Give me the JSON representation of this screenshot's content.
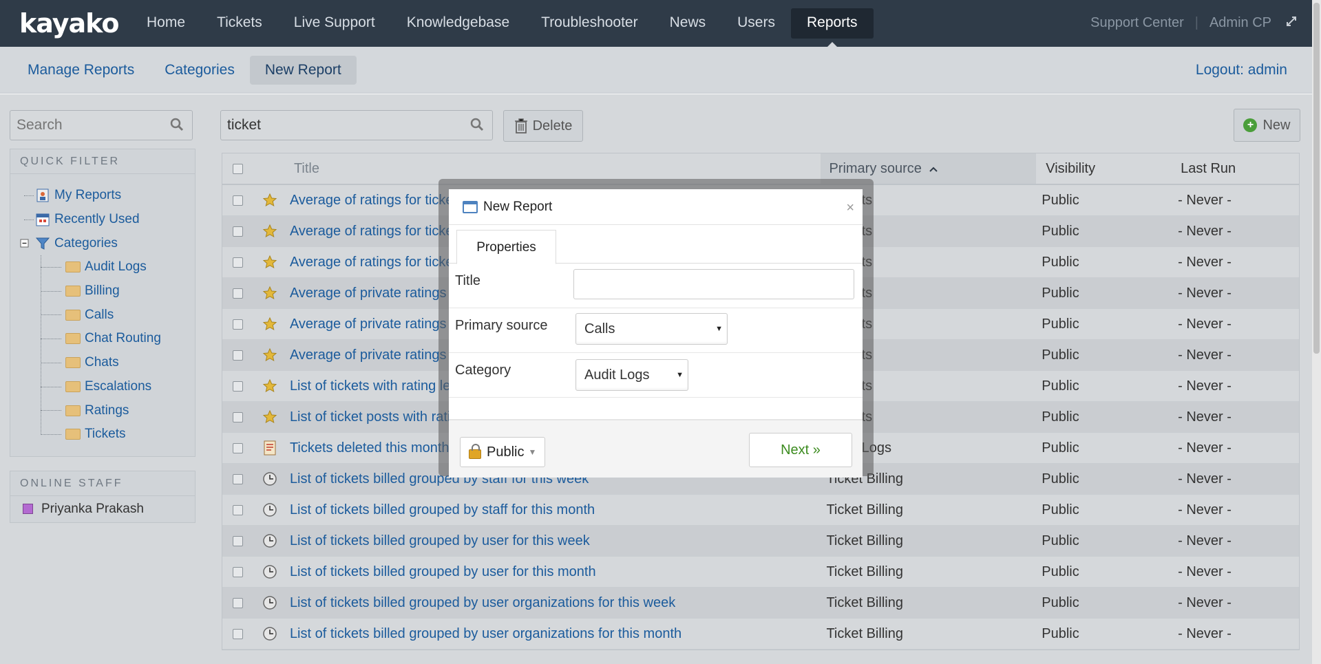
{
  "app": {
    "logo": "kayako"
  },
  "topnav": {
    "items": [
      "Home",
      "Tickets",
      "Live Support",
      "Knowledgebase",
      "Troubleshooter",
      "News",
      "Users",
      "Reports"
    ],
    "active": "Reports",
    "support_center": "Support Center",
    "separator": "|",
    "admin_cp": "Admin CP"
  },
  "subnav": {
    "links": [
      "Manage Reports",
      "Categories",
      "New Report"
    ],
    "active": "New Report",
    "logout": "Logout: admin"
  },
  "sidebar": {
    "search_placeholder": "Search",
    "quick_filter_title": "QUICK FILTER",
    "my_reports": "My Reports",
    "recently_used": "Recently Used",
    "categories": "Categories",
    "category_items": [
      "Audit Logs",
      "Billing",
      "Calls",
      "Chat Routing",
      "Chats",
      "Escalations",
      "Ratings",
      "Tickets"
    ],
    "online_staff_title": "ONLINE STAFF",
    "staff": [
      "Priyanka Prakash"
    ]
  },
  "toolbar": {
    "search_value": "ticket",
    "delete_label": "Delete",
    "new_label": "New"
  },
  "grid": {
    "headers": {
      "title": "Title",
      "source": "Primary source",
      "visibility": "Visibility",
      "last_run": "Last Run"
    },
    "rows": [
      {
        "icon": "star-icon",
        "title": "Average of ratings for ticke",
        "source": "Results",
        "visibility": "Public",
        "last_run": "- Never -"
      },
      {
        "icon": "star-icon",
        "title": "Average of ratings for ticke",
        "source": "Results",
        "visibility": "Public",
        "last_run": "- Never -"
      },
      {
        "icon": "star-icon",
        "title": "Average of ratings for ticke",
        "source": "Results",
        "visibility": "Public",
        "last_run": "- Never -"
      },
      {
        "icon": "star-icon",
        "title": "Average of private ratings",
        "source": "Results",
        "visibility": "Public",
        "last_run": "- Never -"
      },
      {
        "icon": "star-icon",
        "title": "Average of private ratings",
        "source": "Results",
        "visibility": "Public",
        "last_run": "- Never -"
      },
      {
        "icon": "star-icon",
        "title": "Average of private ratings",
        "source": "Results",
        "visibility": "Public",
        "last_run": "- Never -"
      },
      {
        "icon": "star-icon",
        "title": "List of tickets with rating le",
        "source": "Results",
        "visibility": "Public",
        "last_run": "- Never -"
      },
      {
        "icon": "star-icon",
        "title": "List of ticket posts with rati",
        "source": "Results",
        "visibility": "Public",
        "last_run": "- Never -"
      },
      {
        "icon": "document-icon",
        "title": "Tickets deleted this month",
        "source": "Audit Logs",
        "visibility": "Public",
        "last_run": "- Never -"
      },
      {
        "icon": "clock-icon",
        "title": "List of tickets billed grouped by staff for this week",
        "source": "Ticket Billing",
        "visibility": "Public",
        "last_run": "- Never -"
      },
      {
        "icon": "clock-icon",
        "title": "List of tickets billed grouped by staff for this month",
        "source": "Ticket Billing",
        "visibility": "Public",
        "last_run": "- Never -"
      },
      {
        "icon": "clock-icon",
        "title": "List of tickets billed grouped by user for this week",
        "source": "Ticket Billing",
        "visibility": "Public",
        "last_run": "- Never -"
      },
      {
        "icon": "clock-icon",
        "title": "List of tickets billed grouped by user for this month",
        "source": "Ticket Billing",
        "visibility": "Public",
        "last_run": "- Never -"
      },
      {
        "icon": "clock-icon",
        "title": "List of tickets billed grouped by user organizations for this week",
        "source": "Ticket Billing",
        "visibility": "Public",
        "last_run": "- Never -"
      },
      {
        "icon": "clock-icon",
        "title": "List of tickets billed grouped by user organizations for this month",
        "source": "Ticket Billing",
        "visibility": "Public",
        "last_run": "- Never -"
      }
    ]
  },
  "modal": {
    "title": "New Report",
    "close": "×",
    "tab": "Properties",
    "title_label": "Title",
    "title_value": "",
    "source_label": "Primary source",
    "source_value": "Calls",
    "category_label": "Category",
    "category_value": "Audit Logs",
    "visibility_button": "Public",
    "next_button": "Next »"
  },
  "colors": {
    "topbar": "#2f3b48",
    "link": "#1b5b9c",
    "next": "#3c8b1f"
  }
}
